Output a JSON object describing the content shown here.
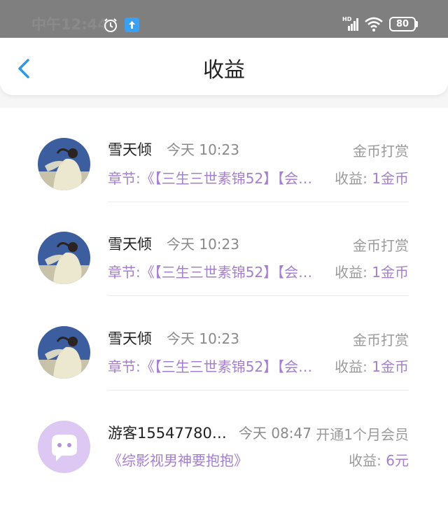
{
  "status_bar": {
    "time": "中午12:44",
    "hd_label": "HD",
    "battery": "80"
  },
  "header": {
    "title": "收益"
  },
  "items": [
    {
      "name": "雪天倾",
      "time": "今天 10:23",
      "type": "金币打赏",
      "chapter": "章节:《【三生三世素锦52】【会…",
      "income_label": "收益: ",
      "income_value": "1金币"
    },
    {
      "name": "雪天倾",
      "time": "今天 10:23",
      "type": "金币打赏",
      "chapter": "章节:《【三生三世素锦52】【会…",
      "income_label": "收益: ",
      "income_value": "1金币"
    },
    {
      "name": "雪天倾",
      "time": "今天 10:23",
      "type": "金币打赏",
      "chapter": "章节:《【三生三世素锦52】【会…",
      "income_label": "收益: ",
      "income_value": "1金币"
    },
    {
      "name": "游客15547780…",
      "time": "今天 08:47",
      "type": "开通1个月会员",
      "chapter": "《综影视男神要抱抱》",
      "income_label": "收益: ",
      "income_value": "6元"
    }
  ],
  "colors": {
    "accent_purple": "#a57fcf",
    "back_blue": "#2e98e6",
    "status_gray": "#7f7f7f",
    "guest_avatar_bg": "#dcc8f2"
  }
}
